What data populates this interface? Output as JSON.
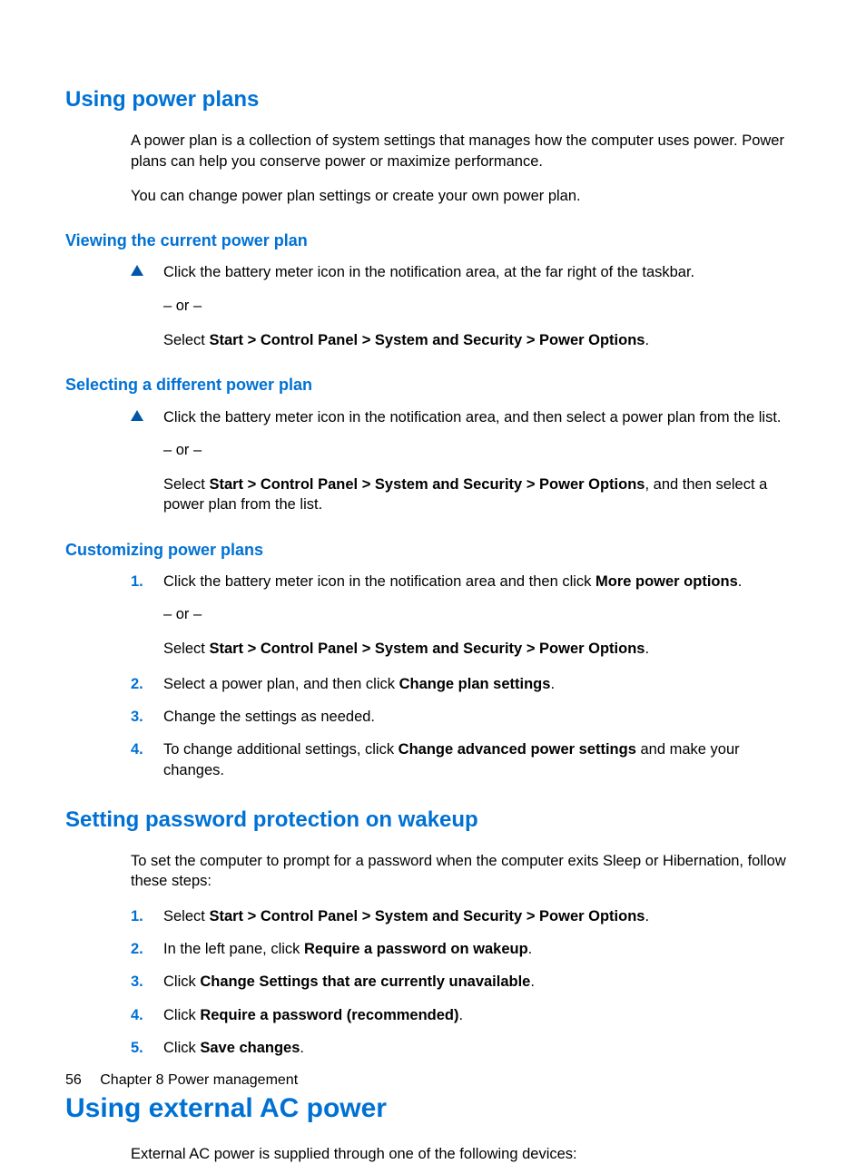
{
  "h2_a": "Using power plans",
  "p_a1": "A power plan is a collection of system settings that manages how the computer uses power. Power plans can help you conserve power or maximize performance.",
  "p_a2": "You can change power plan settings or create your own power plan.",
  "h3_b": "Viewing the current power plan",
  "b1": "Click the battery meter icon in the notification area, at the far right of the taskbar.",
  "or": "– or –",
  "b2_pre": "Select ",
  "b2_bold": "Start > Control Panel > System and Security > Power Options",
  "b2_post": ".",
  "h3_c": "Selecting a different power plan",
  "c1": "Click the battery meter icon in the notification area, and then select a power plan from the list.",
  "c2_pre": "Select ",
  "c2_bold": "Start > Control Panel > System and Security > Power Options",
  "c2_post": ", and then select a power plan from the list.",
  "h3_d": "Customizing power plans",
  "d1_pre": "Click the battery meter icon in the notification area and then click ",
  "d1_bold": "More power options",
  "d1_post": ".",
  "d1b_pre": "Select ",
  "d1b_bold": "Start > Control Panel > System and Security > Power Options",
  "d1b_post": ".",
  "d2_pre": "Select a power plan, and then click ",
  "d2_bold": "Change plan settings",
  "d2_post": ".",
  "d3": "Change the settings as needed.",
  "d4_pre": "To change additional settings, click ",
  "d4_bold": "Change advanced power settings",
  "d4_post": " and make your changes.",
  "h2_e": "Setting password protection on wakeup",
  "e_intro": "To set the computer to prompt for a password when the computer exits Sleep or Hibernation, follow these steps:",
  "e1_pre": "Select ",
  "e1_bold": "Start > Control Panel > System and Security > Power Options",
  "e1_post": ".",
  "e2_pre": "In the left pane, click ",
  "e2_bold": "Require a password on wakeup",
  "e2_post": ".",
  "e3_pre": "Click ",
  "e3_bold": "Change Settings that are currently unavailable",
  "e3_post": ".",
  "e4_pre": "Click ",
  "e4_bold": "Require a password (recommended)",
  "e4_post": ".",
  "e5_pre": "Click ",
  "e5_bold": "Save changes",
  "e5_post": ".",
  "h1_f": "Using external AC power",
  "f1": "External AC power is supplied through one of the following devices:",
  "footer_page": "56",
  "footer_chapter": "Chapter 8   Power management",
  "num1": "1.",
  "num2": "2.",
  "num3": "3.",
  "num4": "4.",
  "num5": "5."
}
